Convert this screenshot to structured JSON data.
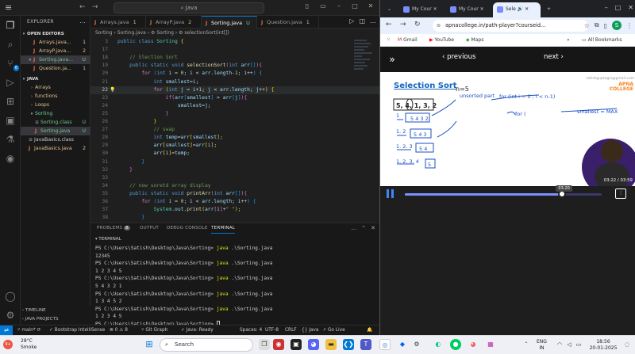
{
  "vscode": {
    "search_text": "Java",
    "sidebar": {
      "title": "EXPLORER",
      "open_editors_label": "OPEN EDITORS",
      "open_editors": [
        {
          "name": "Arrays.java...",
          "status": "1",
          "status_color": "#e2c08d"
        },
        {
          "name": "ArrayP.java...",
          "status": "2",
          "status_color": "#e2c08d"
        },
        {
          "name": "Sorting.java...",
          "status": "U",
          "status_color": "#73c991"
        },
        {
          "name": "Question.ja...",
          "status": "1",
          "status_color": "#e2c08d"
        }
      ],
      "root_label": "JAVA",
      "tree": [
        {
          "name": "Arrays",
          "status": "",
          "kind": "folder",
          "depth": 1,
          "color": "#e2c08d"
        },
        {
          "name": "functions",
          "status": "",
          "kind": "folder",
          "depth": 1,
          "color": "#e2c08d"
        },
        {
          "name": "Loops",
          "status": "",
          "kind": "folder",
          "depth": 1,
          "color": "#e2c08d"
        },
        {
          "name": "Sorting",
          "status": "",
          "kind": "folder-open",
          "depth": 1,
          "color": "#73c991"
        },
        {
          "name": "Sorting.class",
          "status": "U",
          "kind": "file",
          "depth": 2,
          "color": "#73c991"
        },
        {
          "name": "Sorting.java",
          "status": "U",
          "kind": "java",
          "depth": 2,
          "color": "#73c991"
        },
        {
          "name": "JavaBasics.class",
          "status": "",
          "kind": "file",
          "depth": 1,
          "color": "#cccccc"
        },
        {
          "name": "JavaBasics.java",
          "status": "2",
          "kind": "java",
          "depth": 1,
          "color": "#e2c08d"
        }
      ],
      "timeline_label": "TIMELINE",
      "java_projects_label": "JAVA PROJECTS"
    },
    "tabs": [
      {
        "name": "Arrays.java",
        "mark": "1"
      },
      {
        "name": "ArrayP.java",
        "mark": "2"
      },
      {
        "name": "Sorting.java",
        "mark": "U"
      },
      {
        "name": "Question.java",
        "mark": "1"
      }
    ],
    "breadcrumb": "Sorting  ›  Sorting.java  ›  ⚙ Sorting  ›  ⚙ selectionSort(int[])",
    "code_lines": [
      {
        "num": "3",
        "html": "<span class='k'>public</span> <span class='k'>class</span> <span class='t'>Sorting</span> <span class='b1'>{</span>"
      },
      {
        "num": "17",
        "html": ""
      },
      {
        "num": "18",
        "html": "    <span class='c'>// Slection Sort</span>"
      },
      {
        "num": "19",
        "html": "    <span class='k'>public</span> <span class='k'>static</span> <span class='k'>void</span> <span class='f'>selectionSort</span><span class='b2'>(</span><span class='k'>int</span> <span class='v'>arr</span><span class='b3'>[]</span><span class='b2'>)</span><span class='b2'>{</span>"
      },
      {
        "num": "20",
        "html": "        <span class='k2'>for</span> <span class='b3'>(</span><span class='k'>int</span> <span class='v'>i</span> = <span class='n'>0</span>; <span class='v'>i</span> &lt; <span class='v'>arr</span>.<span class='v'>length</span>-<span class='n'>1</span>; <span class='v'>i</span>++<span class='b3'>)</span> <span class='b3'>{</span>"
      },
      {
        "num": "21",
        "html": "            <span class='k'>int</span> <span class='v'>smallest</span>=<span class='v'>i</span>;"
      },
      {
        "num": "22",
        "html": "            <span class='k2'>for</span> <span class='b1'>(</span><span class='k'>int</span> <span class='v'>j</span> = <span class='v'>i</span>+<span class='n'>1</span>; <span class='v'>j</span> &lt; <span class='v'>arr</span>.<span class='v'>length</span>; <span class='v'>j</span>++<span class='b1'>)</span> <span class='b1'>{</span>"
      },
      {
        "num": "23",
        "html": "                <span class='k2'>if</span><span class='b2'>(</span><span class='v'>arr</span><span class='b3'>[</span><span class='v'>smallest</span><span class='b3'>]</span> &gt; <span class='v'>arr</span><span class='b3'>[</span><span class='v'>j</span><span class='b3'>]</span><span class='b2'>)</span><span class='b2'>{</span>"
      },
      {
        "num": "24",
        "html": "                    <span class='v'>smallest</span>=<span class='v'>j</span>;"
      },
      {
        "num": "25",
        "html": "                <span class='b2'>}</span>"
      },
      {
        "num": "26",
        "html": "            <span class='b1'>}</span>"
      },
      {
        "num": "27",
        "html": "            <span class='c'>// swap</span>"
      },
      {
        "num": "28",
        "html": "            <span class='k'>int</span> <span class='v'>temp</span>=<span class='v'>arr</span><span class='b1'>[</span><span class='v'>smallest</span><span class='b1'>]</span>;"
      },
      {
        "num": "29",
        "html": "            <span class='v'>arr</span><span class='b1'>[</span><span class='v'>smallest</span><span class='b1'>]</span>=<span class='v'>arr</span><span class='b1'>[</span><span class='v'>i</span><span class='b1'>]</span>;"
      },
      {
        "num": "30",
        "html": "            <span class='v'>arr</span><span class='b1'>[</span><span class='v'>i</span><span class='b1'>]</span>=<span class='v'>temp</span>;"
      },
      {
        "num": "31",
        "html": "        <span class='b3'>}</span>"
      },
      {
        "num": "32",
        "html": "    <span class='b2'>}</span>"
      },
      {
        "num": "33",
        "html": ""
      },
      {
        "num": "34",
        "html": "    <span class='c'>// now soretd array display</span>"
      },
      {
        "num": "35",
        "html": "    <span class='k'>public</span> <span class='k'>static</span> <span class='k'>void</span> <span class='f'>printArr</span><span class='b2'>(</span><span class='k'>int</span> <span class='v'>arr</span><span class='b3'>[]</span><span class='b2'>)</span><span class='b2'>{</span>"
      },
      {
        "num": "36",
        "html": "        <span class='k2'>for</span> <span class='b3'>(</span><span class='k'>int</span> <span class='v'>i</span> = <span class='n'>0</span>; <span class='v'>i</span> &lt; <span class='v'>arr</span>.<span class='v'>length</span>; <span class='v'>i</span>++<span class='b3'>)</span> <span class='b3'>{</span>"
      },
      {
        "num": "37",
        "html": "            <span class='t'>System</span>.<span class='v'>out</span>.<span class='f'>print</span><span class='b1'>(</span><span class='v'>arr</span><span class='b2'>[</span><span class='v'>i</span><span class='b2'>]</span>+<span class='s'>\" \"</span><span class='b1'>)</span>;"
      },
      {
        "num": "38",
        "html": "        <span class='b3'>}</span>"
      }
    ],
    "current_line": "22",
    "panel": {
      "tabs": [
        "PROBLEMS",
        "OUTPUT",
        "DEBUG CONSOLE",
        "TERMINAL"
      ],
      "problems_count": "8",
      "terminal_header": "TERMINAL",
      "prompt": "PS C:\\Users\\Satish\\Desktop\\Java\\Sorting> ",
      "command": "java",
      "arg": " .\\Sorting.java",
      "outputs": [
        "12345",
        "1 2 3 4 5",
        "5 4 3 2 1",
        "1 3 4 5 2",
        "1 2 3 4 5"
      ]
    },
    "status": {
      "branch": "main*",
      "sync": "⟳",
      "intellisense": "Bootstrap IntelliSense",
      "problems": "⊗ 0  ⚠ 8",
      "gitgraph": "Git Graph",
      "java_ready": "Java: Ready",
      "spaces": "Spaces: 4",
      "encoding": "UTF-8",
      "eol": "CRLF",
      "lang": "{} Java",
      "golive": "Go Live"
    }
  },
  "chrome": {
    "tabs": [
      "My Cour",
      "My Cour",
      "Sele",
      ""
    ],
    "url": "apnacollege.in/path-player?courseid...",
    "bookmarks": [
      "Gmail",
      "YouTube",
      "Maps",
      "All Bookmarks"
    ],
    "avatar_letter": "S",
    "prev_label": "‹ previous",
    "next_label": "next ›",
    "video": {
      "title": "Selection Sort",
      "n_label": "n=5",
      "watermark": "satishguptagis@gmail.com",
      "logo": "APNA COLLEGE",
      "time": "03:22 / 03:59",
      "tooltip": "03:20",
      "progress": 0.8
    }
  },
  "taskbar": {
    "temp": "28°C",
    "weather": "Smoke",
    "search_placeholder": "Search",
    "lang_top": "ENG",
    "lang_bottom": "IN",
    "time": "18:56",
    "date": "20-01-2025"
  }
}
